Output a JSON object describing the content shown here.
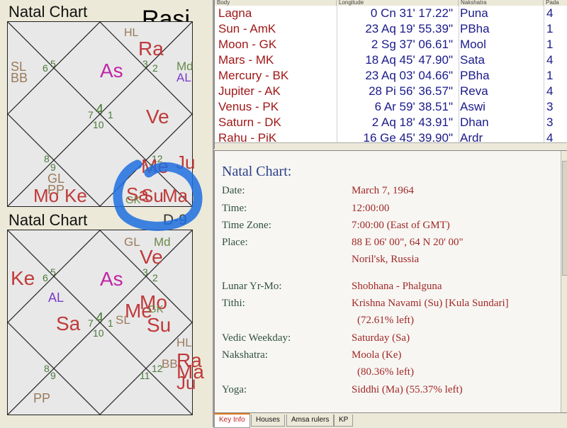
{
  "rasi": {
    "title": "Natal Chart",
    "label": "Rasi",
    "houses": [
      "6",
      "5",
      "3",
      "2",
      "7",
      "4",
      "1",
      "10",
      "8",
      "9",
      "12",
      "11"
    ],
    "planets": {
      "hl": "HL",
      "ra": "Ra",
      "sl": "SL",
      "bb": "BB",
      "as": "As",
      "md": "Md",
      "al": "AL",
      "ve": "Ve",
      "ju": "Ju",
      "gl": "GL",
      "pp": "PP",
      "mo": "Mo",
      "ke": "Ke",
      "me": "Me",
      "sa": "Sa",
      "su": "Su",
      "ma": "Ma",
      "gk": "GK"
    }
  },
  "navamsa": {
    "title": "Natal Chart",
    "label": "D-9",
    "houses": [
      "6",
      "5",
      "3",
      "2",
      "7",
      "4",
      "1",
      "10",
      "8",
      "9",
      "12",
      "11"
    ],
    "planets": {
      "gl": "GL",
      "md": "Md",
      "ve": "Ve",
      "ke": "Ke",
      "as": "As",
      "al": "AL",
      "mo": "Mo",
      "me": "Me",
      "gk": "GK",
      "sa": "Sa",
      "sl": "SL",
      "su": "Su",
      "hl": "HL",
      "bb": "BB",
      "ra": "Ra",
      "ma": "Ma",
      "ju": "Ju",
      "pp": "PP"
    }
  },
  "table": {
    "headers": [
      "Body",
      "Longitude",
      "Nakshatra",
      "Pada"
    ],
    "rows": [
      {
        "body": "Lagna",
        "longitude": "0 Cn 31' 17.22\"",
        "nakshatra": "Puna",
        "pada": "4"
      },
      {
        "body": "Sun - AmK",
        "longitude": "23 Aq 19' 55.39\"",
        "nakshatra": "PBha",
        "pada": "1"
      },
      {
        "body": "Moon - GK",
        "longitude": "2 Sg 37' 06.61\"",
        "nakshatra": "Mool",
        "pada": "1"
      },
      {
        "body": "Mars - MK",
        "longitude": "18 Aq 45' 47.90\"",
        "nakshatra": "Sata",
        "pada": "4"
      },
      {
        "body": "Mercury - BK",
        "longitude": "23 Aq 03' 04.66\"",
        "nakshatra": "PBha",
        "pada": "1"
      },
      {
        "body": "Jupiter - AK",
        "longitude": "28 Pi 56' 36.57\"",
        "nakshatra": "Reva",
        "pada": "4"
      },
      {
        "body": "Venus - PK",
        "longitude": "6 Ar 59' 38.51\"",
        "nakshatra": "Aswi",
        "pada": "3"
      },
      {
        "body": "Saturn - DK",
        "longitude": "2 Aq 18' 43.91\"",
        "nakshatra": "Dhan",
        "pada": "3"
      },
      {
        "body": "Rahu - PiK",
        "longitude": "16 Ge 45' 39.90\"",
        "nakshatra": "Ardr",
        "pada": "4"
      }
    ]
  },
  "info": {
    "title": "Natal Chart:",
    "date_label": "Date:",
    "date": "March 7, 1964",
    "time_label": "Time:",
    "time": "12:00:00",
    "tz_label": "Time Zone:",
    "tz": "7:00:00 (East of GMT)",
    "place_label": "Place:",
    "place": "88 E 06' 00\", 64 N 20' 00\"",
    "place2": "Noril'sk, Russia",
    "lunar_label": "Lunar Yr-Mo:",
    "lunar": "Shobhana - Phalguna",
    "tithi_label": "Tithi:",
    "tithi": "Krishna Navami (Su) [Kula Sundari]",
    "tithi2": "(72.61% left)",
    "weekday_label": "Vedic Weekday:",
    "weekday": "Saturday (Sa)",
    "nakshatra_label": "Nakshatra:",
    "nakshatra": "Moola (Ke)",
    "nakshatra2": "(80.36% left)",
    "yoga_label": "Yoga:",
    "yoga": "Siddhi (Ma) (55.37% left)"
  },
  "tabs": [
    "Key Info",
    "Houses",
    "Amsa rulers",
    "KP"
  ],
  "colors": {
    "highlight": "#1e6fe0",
    "body_text": "#a01818",
    "value_text": "#1a1a8a",
    "active_tab": "#c02020"
  }
}
